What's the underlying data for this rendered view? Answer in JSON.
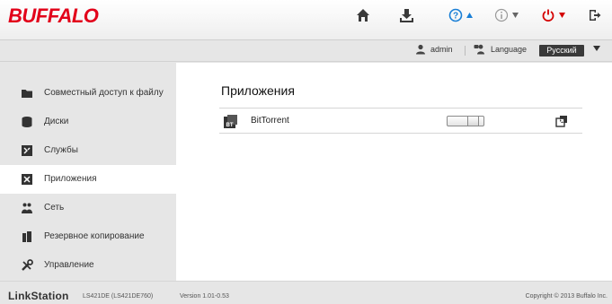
{
  "header": {
    "logo": "BUFFALO",
    "icons": [
      "home-icon",
      "download-icon",
      "help-icon",
      "info-icon",
      "power-icon",
      "logout-icon"
    ]
  },
  "userbar": {
    "username": "admin",
    "language_label": "Language",
    "language_value": "Русский"
  },
  "sidebar": {
    "items": [
      {
        "label": "Совместный доступ к файлу",
        "icon": "folder-icon"
      },
      {
        "label": "Диски",
        "icon": "disk-icon"
      },
      {
        "label": "Службы",
        "icon": "services-icon"
      },
      {
        "label": "Приложения",
        "icon": "apps-icon"
      },
      {
        "label": "Сеть",
        "icon": "network-icon"
      },
      {
        "label": "Резервное копирование",
        "icon": "backup-icon"
      },
      {
        "label": "Управление",
        "icon": "tools-icon"
      }
    ],
    "active_index": 3
  },
  "content": {
    "title": "Приложения",
    "apps": [
      {
        "name": "BitTorrent",
        "icon": "bittorrent-icon",
        "toggle_state": "off"
      }
    ]
  },
  "footer": {
    "brand": "LinkStation",
    "model": "LS421DE (LS421DE760)",
    "version": "Version 1.01-0.53",
    "copyright": "Copyright © 2013 Buffalo Inc."
  },
  "colors": {
    "brand_red": "#e2001a",
    "help_blue": "#1a7fd6",
    "power_red": "#d40000"
  }
}
